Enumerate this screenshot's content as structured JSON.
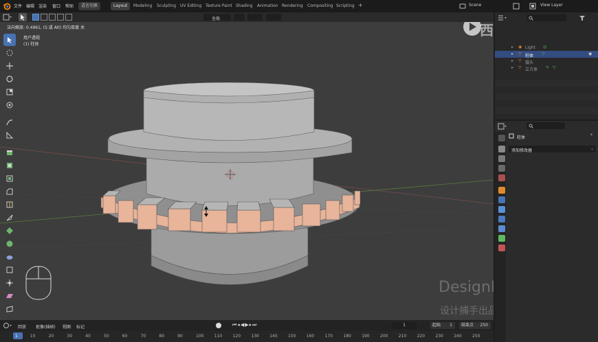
{
  "topbar": {
    "menu": [
      "文件",
      "编辑",
      "渲染",
      "窗口",
      "帮助"
    ],
    "lang_switch": "语言切换",
    "workspaces": [
      "Layout",
      "Modeling",
      "Sculpting",
      "UV Editing",
      "Texture Paint",
      "Shading",
      "Animation",
      "Rendering",
      "Compositing",
      "Scripting"
    ],
    "active_workspace": "Layout",
    "scene": "Scene",
    "view_layer": "View Layer"
  },
  "header": {
    "transform_orientation": "全局"
  },
  "viewport": {
    "status_text": "法向缩放: 0.4961, (S 或 Alt) 均匀厚度 关",
    "view_name": "用户透视",
    "object_name": "(1) 柱体"
  },
  "watermark": {
    "brand": "西瓜视频",
    "title": "DesignHunting",
    "subtitle": "设计捕手出品-基础部分"
  },
  "outliner": {
    "items": [
      {
        "label": "Light",
        "selected": false
      },
      {
        "label": "柱体",
        "selected": true
      },
      {
        "label": "摄头",
        "selected": false
      },
      {
        "label": "立方体",
        "selected": false
      }
    ]
  },
  "properties": {
    "object_name": "柱体",
    "add_modifier": "添加修改器"
  },
  "timeline": {
    "menu": [
      "回放",
      "抠像(插帧)",
      "视图",
      "标记"
    ],
    "current_frame": "1",
    "start_label": "起始",
    "start_value": "1",
    "end_label": "结束点",
    "end_value": "250",
    "ruler": [
      "1",
      "10",
      "20",
      "30",
      "40",
      "50",
      "60",
      "70",
      "80",
      "90",
      "100",
      "110",
      "120",
      "130",
      "140",
      "150",
      "160",
      "170",
      "180",
      "190",
      "200",
      "210",
      "220",
      "230",
      "240",
      "250"
    ]
  },
  "colors": {
    "accent": "#4772b3",
    "selection_orange": "#ff9a2e",
    "viewport_bg": "#3d3d3d"
  }
}
